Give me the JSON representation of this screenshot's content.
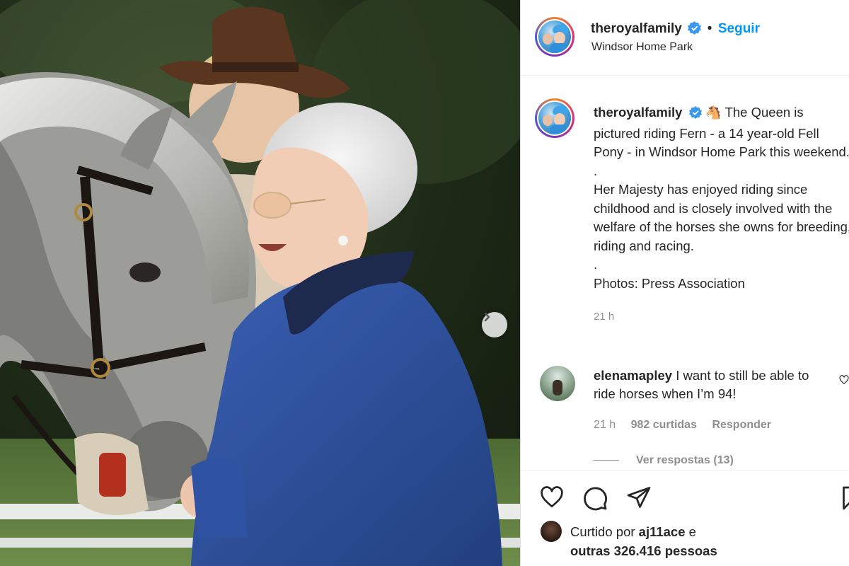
{
  "post": {
    "username": "theroyalfamily",
    "follow_label": "Seguir",
    "location": "Windsor Home Park"
  },
  "caption": {
    "username": "theroyalfamily",
    "emoji": "🐴",
    "line1": "The Queen is pictured riding Fern - a 14 year-old Fell Pony - in Windsor Home Park this weekend.",
    "sep1": ".",
    "line2": "Her Majesty has enjoyed riding since childhood and is closely involved with the welfare of the horses she owns for breeding, riding and racing.",
    "sep2": ".",
    "line3": "Photos: Press Association",
    "time": "21 h"
  },
  "comment": {
    "username": "elenamapley",
    "text": "I want to still be able to ride horses when I’m 94!",
    "time": "21 h",
    "likes": "982 curtidas",
    "reply_label": "Responder",
    "view_replies": "Ver respostas (13)"
  },
  "likes": {
    "prefix": "Curtido por",
    "user": "aj11ace",
    "conj": "e",
    "others": "outras 326.416 pessoas"
  },
  "icons": {
    "verified": "verified-badge-icon",
    "next": "chevron-right-icon",
    "like": "heart-icon",
    "comment": "speech-bubble-icon",
    "share": "paper-plane-icon",
    "save": "bookmark-icon"
  },
  "colors": {
    "accent": "#0095f6",
    "text": "#262626",
    "muted": "#8e8e8e",
    "coat": "#2e4f9e"
  }
}
